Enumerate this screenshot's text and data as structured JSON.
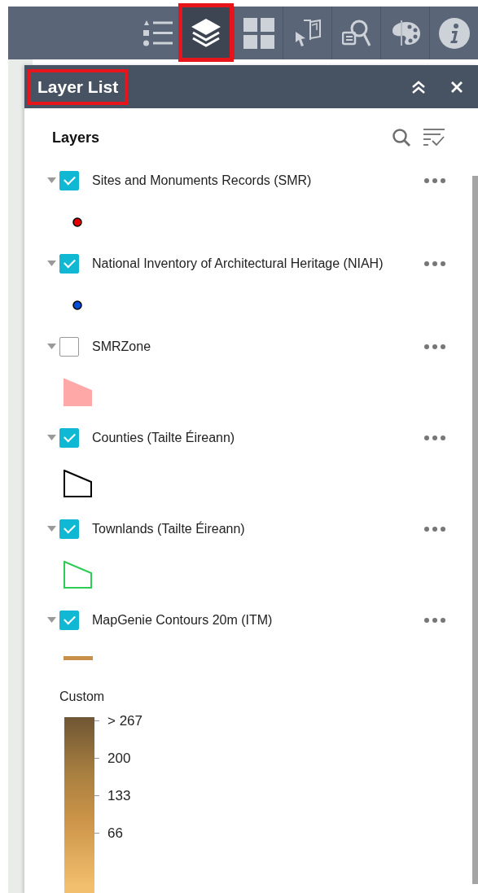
{
  "toolbar": [
    {
      "kind": "list",
      "selected": false,
      "highlighted": false
    },
    {
      "kind": "layers",
      "selected": true,
      "highlighted": true
    },
    {
      "kind": "grid",
      "selected": false,
      "highlighted": false
    },
    {
      "kind": "select",
      "selected": false,
      "highlighted": false
    },
    {
      "kind": "query",
      "selected": false,
      "highlighted": false
    },
    {
      "kind": "palette",
      "selected": false,
      "highlighted": false
    },
    {
      "kind": "info",
      "selected": false,
      "highlighted": false
    }
  ],
  "panel": {
    "title": "Layer List",
    "title_highlighted": true,
    "heading": "Layers",
    "layers": [
      {
        "name": "Sites and Monuments Records (SMR)",
        "checked": true,
        "legend": {
          "kind": "marker",
          "color": "#e60000"
        }
      },
      {
        "name": "National Inventory of Architectural Heritage (NIAH)",
        "checked": true,
        "legend": {
          "kind": "marker",
          "color": "#004dd9"
        }
      },
      {
        "name": "SMRZone",
        "checked": false,
        "legend": {
          "kind": "polygon",
          "color": "#ffa8a8",
          "filled": true
        }
      },
      {
        "name": "Counties (Tailte Éireann)",
        "checked": true,
        "legend": {
          "kind": "polygon",
          "color": "#000000",
          "filled": false
        }
      },
      {
        "name": "Townlands (Tailte Éireann)",
        "checked": true,
        "legend": {
          "kind": "polygon",
          "color": "#2ecc55",
          "filled": false
        }
      },
      {
        "name": "MapGenie Contours 20m (ITM)",
        "checked": true,
        "legend": {
          "kind": "line",
          "color": "#c8914a"
        },
        "ramp": {
          "title": "Custom",
          "labels": [
            "> 267",
            "200",
            "133",
            "66"
          ]
        }
      }
    ]
  }
}
